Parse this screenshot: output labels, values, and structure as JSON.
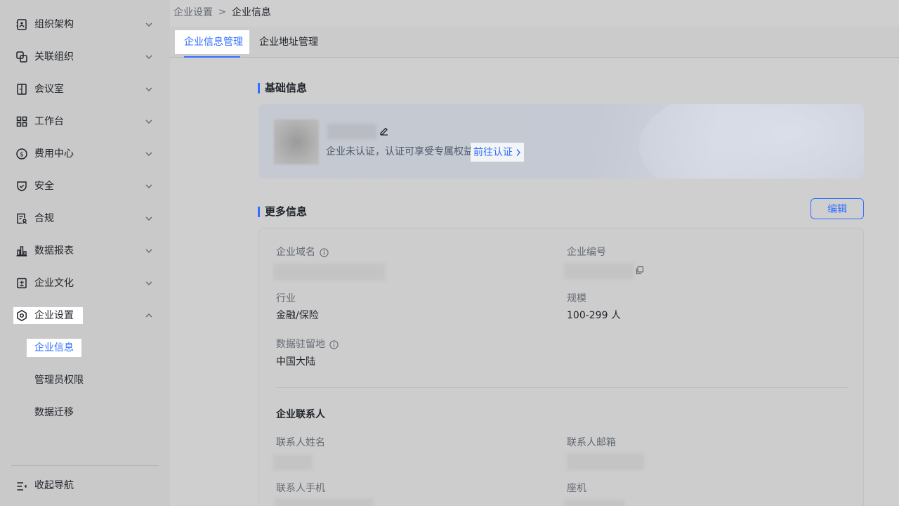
{
  "sidebar": {
    "items": [
      {
        "label": "组织架构",
        "icon": "org-chart-icon",
        "expanded": false
      },
      {
        "label": "关联组织",
        "icon": "linked-org-icon",
        "expanded": false
      },
      {
        "label": "会议室",
        "icon": "meeting-room-icon",
        "expanded": false
      },
      {
        "label": "工作台",
        "icon": "workplace-icon",
        "expanded": false
      },
      {
        "label": "费用中心",
        "icon": "billing-icon",
        "expanded": false
      },
      {
        "label": "安全",
        "icon": "shield-icon",
        "expanded": false
      },
      {
        "label": "合规",
        "icon": "compliance-icon",
        "expanded": false
      },
      {
        "label": "数据报表",
        "icon": "bar-chart-icon",
        "expanded": false
      },
      {
        "label": "企业文化",
        "icon": "culture-icon",
        "expanded": false
      },
      {
        "label": "企业设置",
        "icon": "settings-hex-icon",
        "expanded": true
      }
    ],
    "subitems": [
      {
        "label": "企业信息",
        "active": true
      },
      {
        "label": "管理员权限",
        "active": false
      },
      {
        "label": "数据迁移",
        "active": false
      }
    ],
    "collapse_label": "收起导航"
  },
  "breadcrumb": {
    "parent": "企业设置",
    "separator": ">",
    "current": "企业信息"
  },
  "tabs": [
    {
      "label": "企业信息管理",
      "active": true
    },
    {
      "label": "企业地址管理",
      "active": false
    }
  ],
  "basic": {
    "title": "基础信息",
    "cert_text": "企业未认证，认证可享受专属权益",
    "cert_link": "前往认证"
  },
  "more": {
    "title": "更多信息",
    "edit_label": "编辑",
    "domain_label": "企业域名",
    "id_label": "企业编号",
    "industry_label": "行业",
    "industry_value": "金融/保险",
    "scale_label": "规模",
    "scale_value": "100-299 人",
    "residency_label": "数据驻留地",
    "residency_value": "中国大陆",
    "contact_heading": "企业联系人",
    "contact_name_label": "联系人姓名",
    "contact_email_label": "联系人邮箱",
    "contact_phone_label": "联系人手机",
    "landline_label": "座机"
  },
  "colors": {
    "accent": "#3370ff",
    "sidebar_bg": "#c9c9c9",
    "main_bg": "#cfcfcf"
  }
}
